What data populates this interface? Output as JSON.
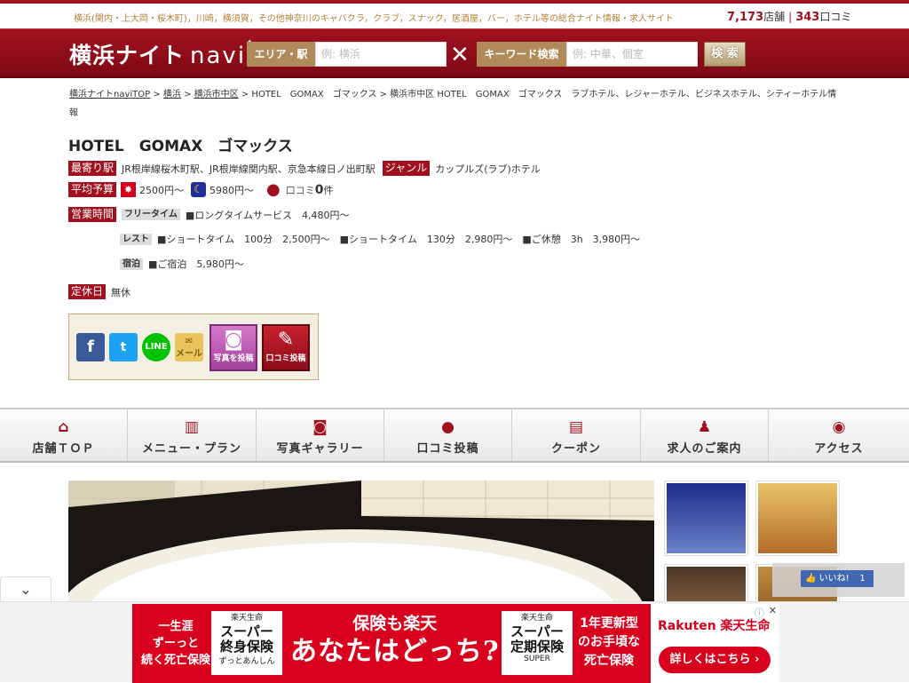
{
  "site": {
    "tagline": "横浜(関内・上大岡・桜木町)，川崎，横須賀，その他神奈川のキャバクラ，クラブ，スナック，居酒屋，バー，ホテル等の総合ナイト情報・求人サイト",
    "store_count": "7,173",
    "store_unit": "店舗",
    "review_count": "343",
    "review_unit": "口コミ",
    "logo_main": "横浜ナイト",
    "logo_navi": "navi"
  },
  "search": {
    "area_label": "エリア・駅",
    "area_placeholder": "例: 横浜",
    "keyword_label": "キーワード検索",
    "keyword_placeholder": "例: 中華、個室",
    "button": "検 索"
  },
  "breadcrumb": {
    "items": [
      "横浜ナイトnaviTOP",
      "横浜",
      "横浜市中区"
    ],
    "current": "HOTEL　GOMAX　ゴマックス > 横浜市中区 HOTEL　GOMAX　ゴマックス　ラブホテル、レジャーホテル、ビジネスホテル、シティーホテル情報"
  },
  "shop": {
    "title": "HOTEL　GOMAX　ゴマックス",
    "station_label": "最寄り駅",
    "station": "JR根岸線桜木町駅、JR根岸線関内駅、京急本線日ノ出町駅",
    "genre_label": "ジャンル",
    "genre": "カップルズ(ラブ)ホテル",
    "budget_label": "平均予算",
    "budget_day": "2500円〜",
    "budget_night": "5980円〜",
    "review_prefix": "口コミ",
    "review_num": "0",
    "review_suffix": "件",
    "hours_label": "営業時間",
    "free_label": "フリータイム",
    "free_text": "■ロングタイムサービス　4,480円〜",
    "rest_label": "レスト",
    "rest_text": "■ショートタイム　100分　2,500円〜　■ショートタイム　130分　2,980円〜　■ご休憩　3h　3,980円〜",
    "stay_label": "宿泊",
    "stay_text": "■ご宿泊　5,980円〜",
    "holiday_label": "定休日",
    "holiday": "無休"
  },
  "share": {
    "facebook": "f",
    "twitter": "t",
    "line": "LINE",
    "mail": "メール",
    "photo_post": "写真を投稿",
    "review_post": "口コミ投稿"
  },
  "tabs": [
    {
      "label": "店舗ＴＯＰ",
      "icon": "home-icon",
      "glyph": "⌂"
    },
    {
      "label": "メニュー・プラン",
      "icon": "book-icon",
      "glyph": "📖"
    },
    {
      "label": "写真ギャラリー",
      "icon": "camera-icon",
      "glyph": "◙"
    },
    {
      "label": "口コミ投稿",
      "icon": "speech-bubble-icon",
      "glyph": "●"
    },
    {
      "label": "クーポン",
      "icon": "coupon-icon",
      "glyph": "▤"
    },
    {
      "label": "求人のご案内",
      "icon": "person-icon",
      "glyph": "♟"
    },
    {
      "label": "アクセス",
      "icon": "map-pin-icon",
      "glyph": "◉"
    }
  ],
  "like": {
    "label": "いいね!",
    "count": "1"
  },
  "ad": {
    "left_text": "一生涯\nずーっと\n続く死亡保険",
    "box1_top": "楽天生命",
    "box1_big": "スーパー\n終身保険",
    "box1_sub": "ずっとあんしん",
    "mid_top": "保険も楽天",
    "mid_big": "あなたはどっち?",
    "box2_top": "楽天生命",
    "box2_big": "スーパー\n定期保険",
    "box2_sub": "SUPER",
    "right_text": "1年更新型\nのお手頃な\n死亡保険",
    "brand": "Rakuten 楽天生命",
    "cta": "詳しくはこちら ›"
  },
  "colors": {
    "brand": "#a0101e",
    "gold": "#b08a5a",
    "facebook": "#4267b2"
  }
}
